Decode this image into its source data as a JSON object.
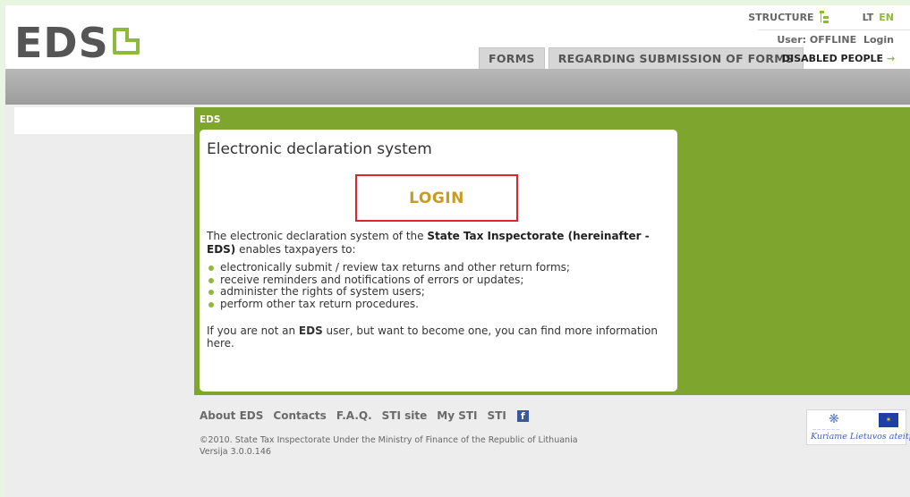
{
  "header": {
    "logo_text": "EDS",
    "structure_label": "STRUCTURE",
    "lang_lt": "LT",
    "lang_en": "EN",
    "user_status": "User: OFFLINE",
    "login_link": "Login",
    "tabs": [
      {
        "label": "FORMS"
      },
      {
        "label": "REGARDING SUBMISSION OF FORMS"
      }
    ],
    "disabled_people": "DISABLED PEOPLE",
    "disabled_arrow": "→"
  },
  "main": {
    "section_label": "EDS",
    "card_title": "Electronic declaration system",
    "login_button": "LOGIN",
    "intro_pre": "The electronic declaration system of the ",
    "intro_bold": "State Tax Inspectorate (hereinafter - EDS)",
    "intro_post": " enables taxpayers to:",
    "bullets": [
      "electronically submit / review tax returns and other return forms;",
      "receive reminders and notifications of errors or updates;",
      "administer the rights of system users;",
      "perform other tax return procedures."
    ],
    "not_user_pre": "If you are not an ",
    "not_user_bold": "EDS",
    "not_user_post": " user, but want to become one, you can find more information here."
  },
  "footer": {
    "links": [
      "About EDS",
      "Contacts",
      "F.A.Q.",
      "STI site",
      "My STI",
      "STI"
    ],
    "fb_glyph": "f",
    "copyright": "©2010. State Tax Inspectorate Under the Ministry of Finance of the Republic of Lithuania",
    "version": "Versija 3.0.0.146",
    "eu_slogan": "Kuriame Lietuvos ateitį"
  },
  "colors": {
    "accent_green": "#7ea62f",
    "login_text": "#c89b21",
    "login_border": "#d9262e"
  }
}
